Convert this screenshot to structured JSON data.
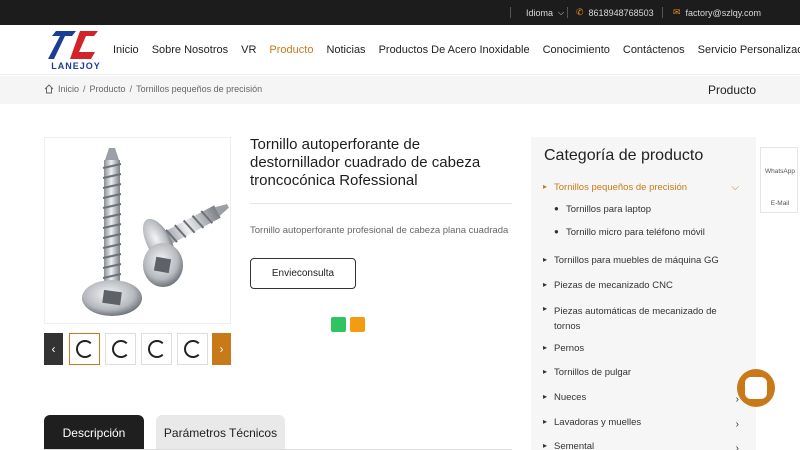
{
  "topbar": {
    "language": "Idioma",
    "phone": "8618948768503",
    "email": "factory@szlqy.com"
  },
  "brand": {
    "logo_text": "LANEJOY",
    "accent": "#c97a18",
    "logo_blue": "#1c3d94",
    "logo_red": "#d2232a"
  },
  "nav": {
    "items": [
      {
        "label": "Inicio"
      },
      {
        "label": "Sobre Nosotros"
      },
      {
        "label": "VR"
      },
      {
        "label": "Producto"
      },
      {
        "label": "Noticias"
      },
      {
        "label": "Productos De Acero Inoxidable"
      },
      {
        "label": "Conocimiento"
      },
      {
        "label": "Contáctenos"
      },
      {
        "label": "Servicio Personalizado"
      }
    ]
  },
  "breadcrumb": {
    "home": "Inicio",
    "sep": "/",
    "section": "Producto",
    "current": "Tornillos pequeños de precisión",
    "right_title": "Producto"
  },
  "gallery": {
    "prev_icon": "‹",
    "next_icon": "›"
  },
  "product": {
    "title": "Tornillo autoperforante de destornillador cuadrado de cabeza troncocónica Rofessional",
    "description": "Tornillo autoperforante profesional de cabeza plana cuadrada",
    "inquiry_label": "Envieconsulta"
  },
  "share": {
    "colors": [
      "#2fc361",
      "#f39c12"
    ]
  },
  "tabs": [
    {
      "label": "Descripción"
    },
    {
      "label": "Parámetros Técnicos"
    }
  ],
  "sidebar": {
    "title": "Categoría de producto",
    "categories": [
      {
        "label": "Tornillos pequeños de precisión",
        "expanded": true
      },
      {
        "label": "Tornillos para laptop"
      },
      {
        "label": "Tornillo micro para teléfono móvil"
      },
      {
        "label": "Tornillos para muebles de máquina GG"
      },
      {
        "label": "Piezas de mecanizado CNC"
      },
      {
        "label": "Piezas automáticas de mecanizado de tornos"
      },
      {
        "label": "Pernos"
      },
      {
        "label": "Tornillos de pulgar"
      },
      {
        "label": "Nueces"
      },
      {
        "label": "Lavadoras y muelles"
      },
      {
        "label": "Semental"
      }
    ]
  },
  "floating": {
    "whatsapp": "WhatsApp",
    "email": "E-Mail"
  }
}
